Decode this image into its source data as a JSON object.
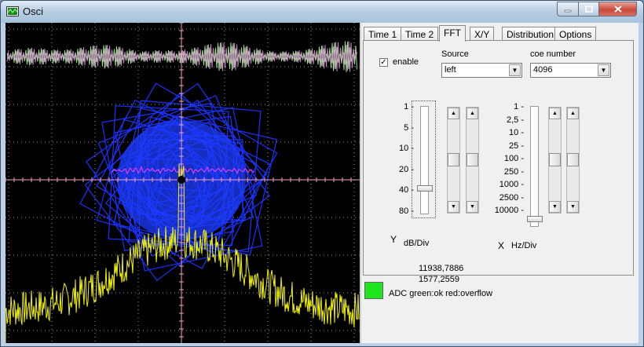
{
  "window": {
    "title": "Osci"
  },
  "tabs": [
    "Time 1",
    "Time 2",
    "FFT",
    "X/Y",
    "Distribution",
    "Options"
  ],
  "active_tab": "FFT",
  "fft": {
    "enable_label": "enable",
    "enable_checked": true,
    "enable_mark": "✓",
    "source_label": "Source",
    "source_value": "left",
    "coe_label": "coe number",
    "coe_value": "4096",
    "y_ticks": [
      "1",
      "5",
      "10",
      "20",
      "40",
      "80"
    ],
    "y_axis_label": "Y",
    "y_unit_label": "dB/Div",
    "x_ticks": [
      "1",
      "2,5",
      "10",
      "25",
      "100",
      "250",
      "1000",
      "2500",
      "10000"
    ],
    "x_axis_label": "X",
    "x_unit_label": "Hz/Div",
    "readout_1": "11938,7886",
    "readout_2": "1577,2559"
  },
  "status": {
    "adc_label": "ADC green:ok red:overflow",
    "adc_color": "#1ee51e"
  },
  "colors": {
    "waveform": "#b8e8b0",
    "xy_trace": "#1a33ff",
    "fft_trace": "#f2f200",
    "crosshair": "#f0a0c8",
    "grid": "#9a9a9a"
  },
  "icons": {
    "app": "oscilloscope-app-icon",
    "minimize": "minimize-icon",
    "maximize": "maximize-icon",
    "close": "close-icon"
  }
}
